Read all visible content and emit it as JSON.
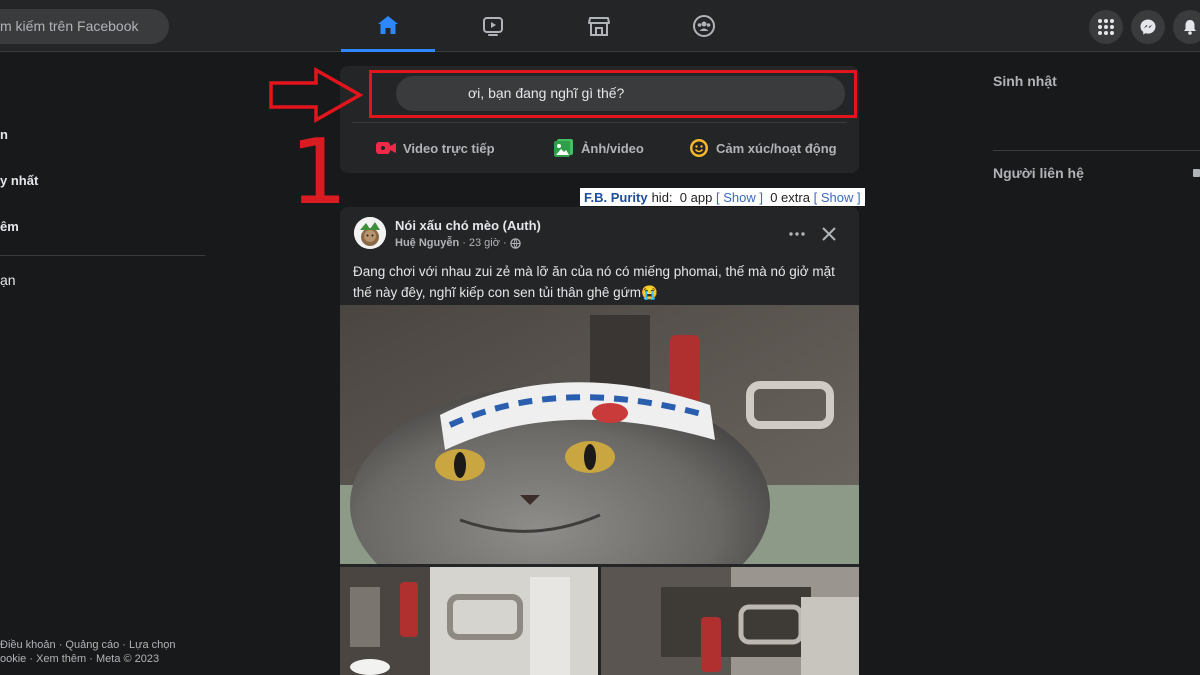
{
  "topbar": {
    "search_placeholder": "m kiếm trên Facebook",
    "tabs": [
      "home",
      "watch",
      "marketplace",
      "groups"
    ],
    "active_tab": "home",
    "accent": "#2d88ff"
  },
  "left_sidebar": {
    "items": [
      "n",
      "y nhất",
      "êm",
      "ạn"
    ],
    "footer": [
      "Điều khoản · Quảng cáo · Lựa chọn",
      "ookie · Xem thêm · Meta © 2023"
    ]
  },
  "composer": {
    "placeholder": "ơi, bạn đang nghĩ gì thế?",
    "actions": [
      {
        "label": "Video trực tiếp",
        "icon": "live-video-icon",
        "color": "#f02849"
      },
      {
        "label": "Ảnh/video",
        "icon": "photo-icon",
        "color": "#45bd62"
      },
      {
        "label": "Cảm xúc/hoạt động",
        "icon": "feeling-icon",
        "color": "#f7b928"
      }
    ]
  },
  "annotation": {
    "step": "1",
    "color": "#e3141c"
  },
  "fb_purity": {
    "brand": "F.B. Purity",
    "hid": "hid:",
    "apps": "0 app",
    "show1": "Show",
    "extra": "0 extra",
    "show2": "Show",
    "open_bracket": "[",
    "close_bracket": "]"
  },
  "post": {
    "group_name": "Nói xấu chó mèo (Auth)",
    "author": "Huệ Nguyễn",
    "time": "23 giờ",
    "text": "Đang chơi với nhau zui zẻ mà lỡ ăn của nó có miếng phomai, thế mà nó giở mặt thế này đêy, nghĩ kiếp con sen tủi thân ghê gứm😭"
  },
  "right_sidebar": {
    "birthdays_title": "Sinh nhật",
    "contacts_title": "Người liên hệ"
  }
}
